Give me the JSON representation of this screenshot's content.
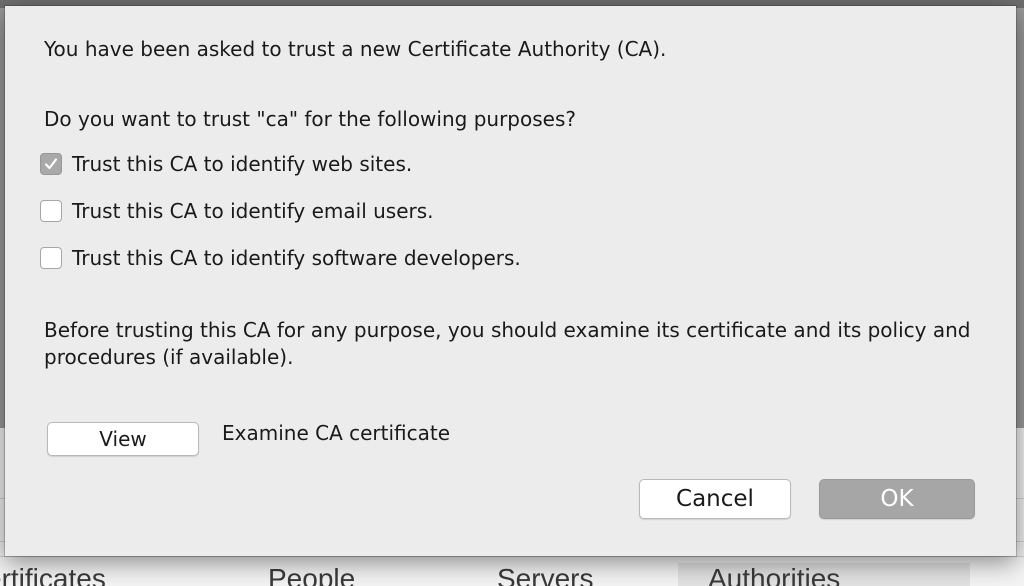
{
  "background": {
    "tabs": [
      "ertificates",
      "People",
      "Servers",
      "Authorities"
    ],
    "selected_tab": "Authorities"
  },
  "dialog": {
    "intro": "You have been asked to trust a new Certificate Authority (CA).",
    "question": "Do you want to trust \"ca\" for the following purposes?",
    "options": [
      {
        "label": "Trust this CA to identify web sites.",
        "checked": true
      },
      {
        "label": "Trust this CA to identify email users.",
        "checked": false
      },
      {
        "label": "Trust this CA to identify software developers.",
        "checked": false
      }
    ],
    "advice": "Before trusting this CA for any purpose, you should examine its certificate and its policy and procedures (if available).",
    "view_button": "View",
    "view_caption": "Examine CA certificate",
    "cancel_button": "Cancel",
    "ok_button": "OK",
    "ok_enabled": false
  },
  "colors": {
    "dialog_bg": "#ececec",
    "checked_bg": "#a9a9a9",
    "disabled_button": "#a6a6a6"
  }
}
